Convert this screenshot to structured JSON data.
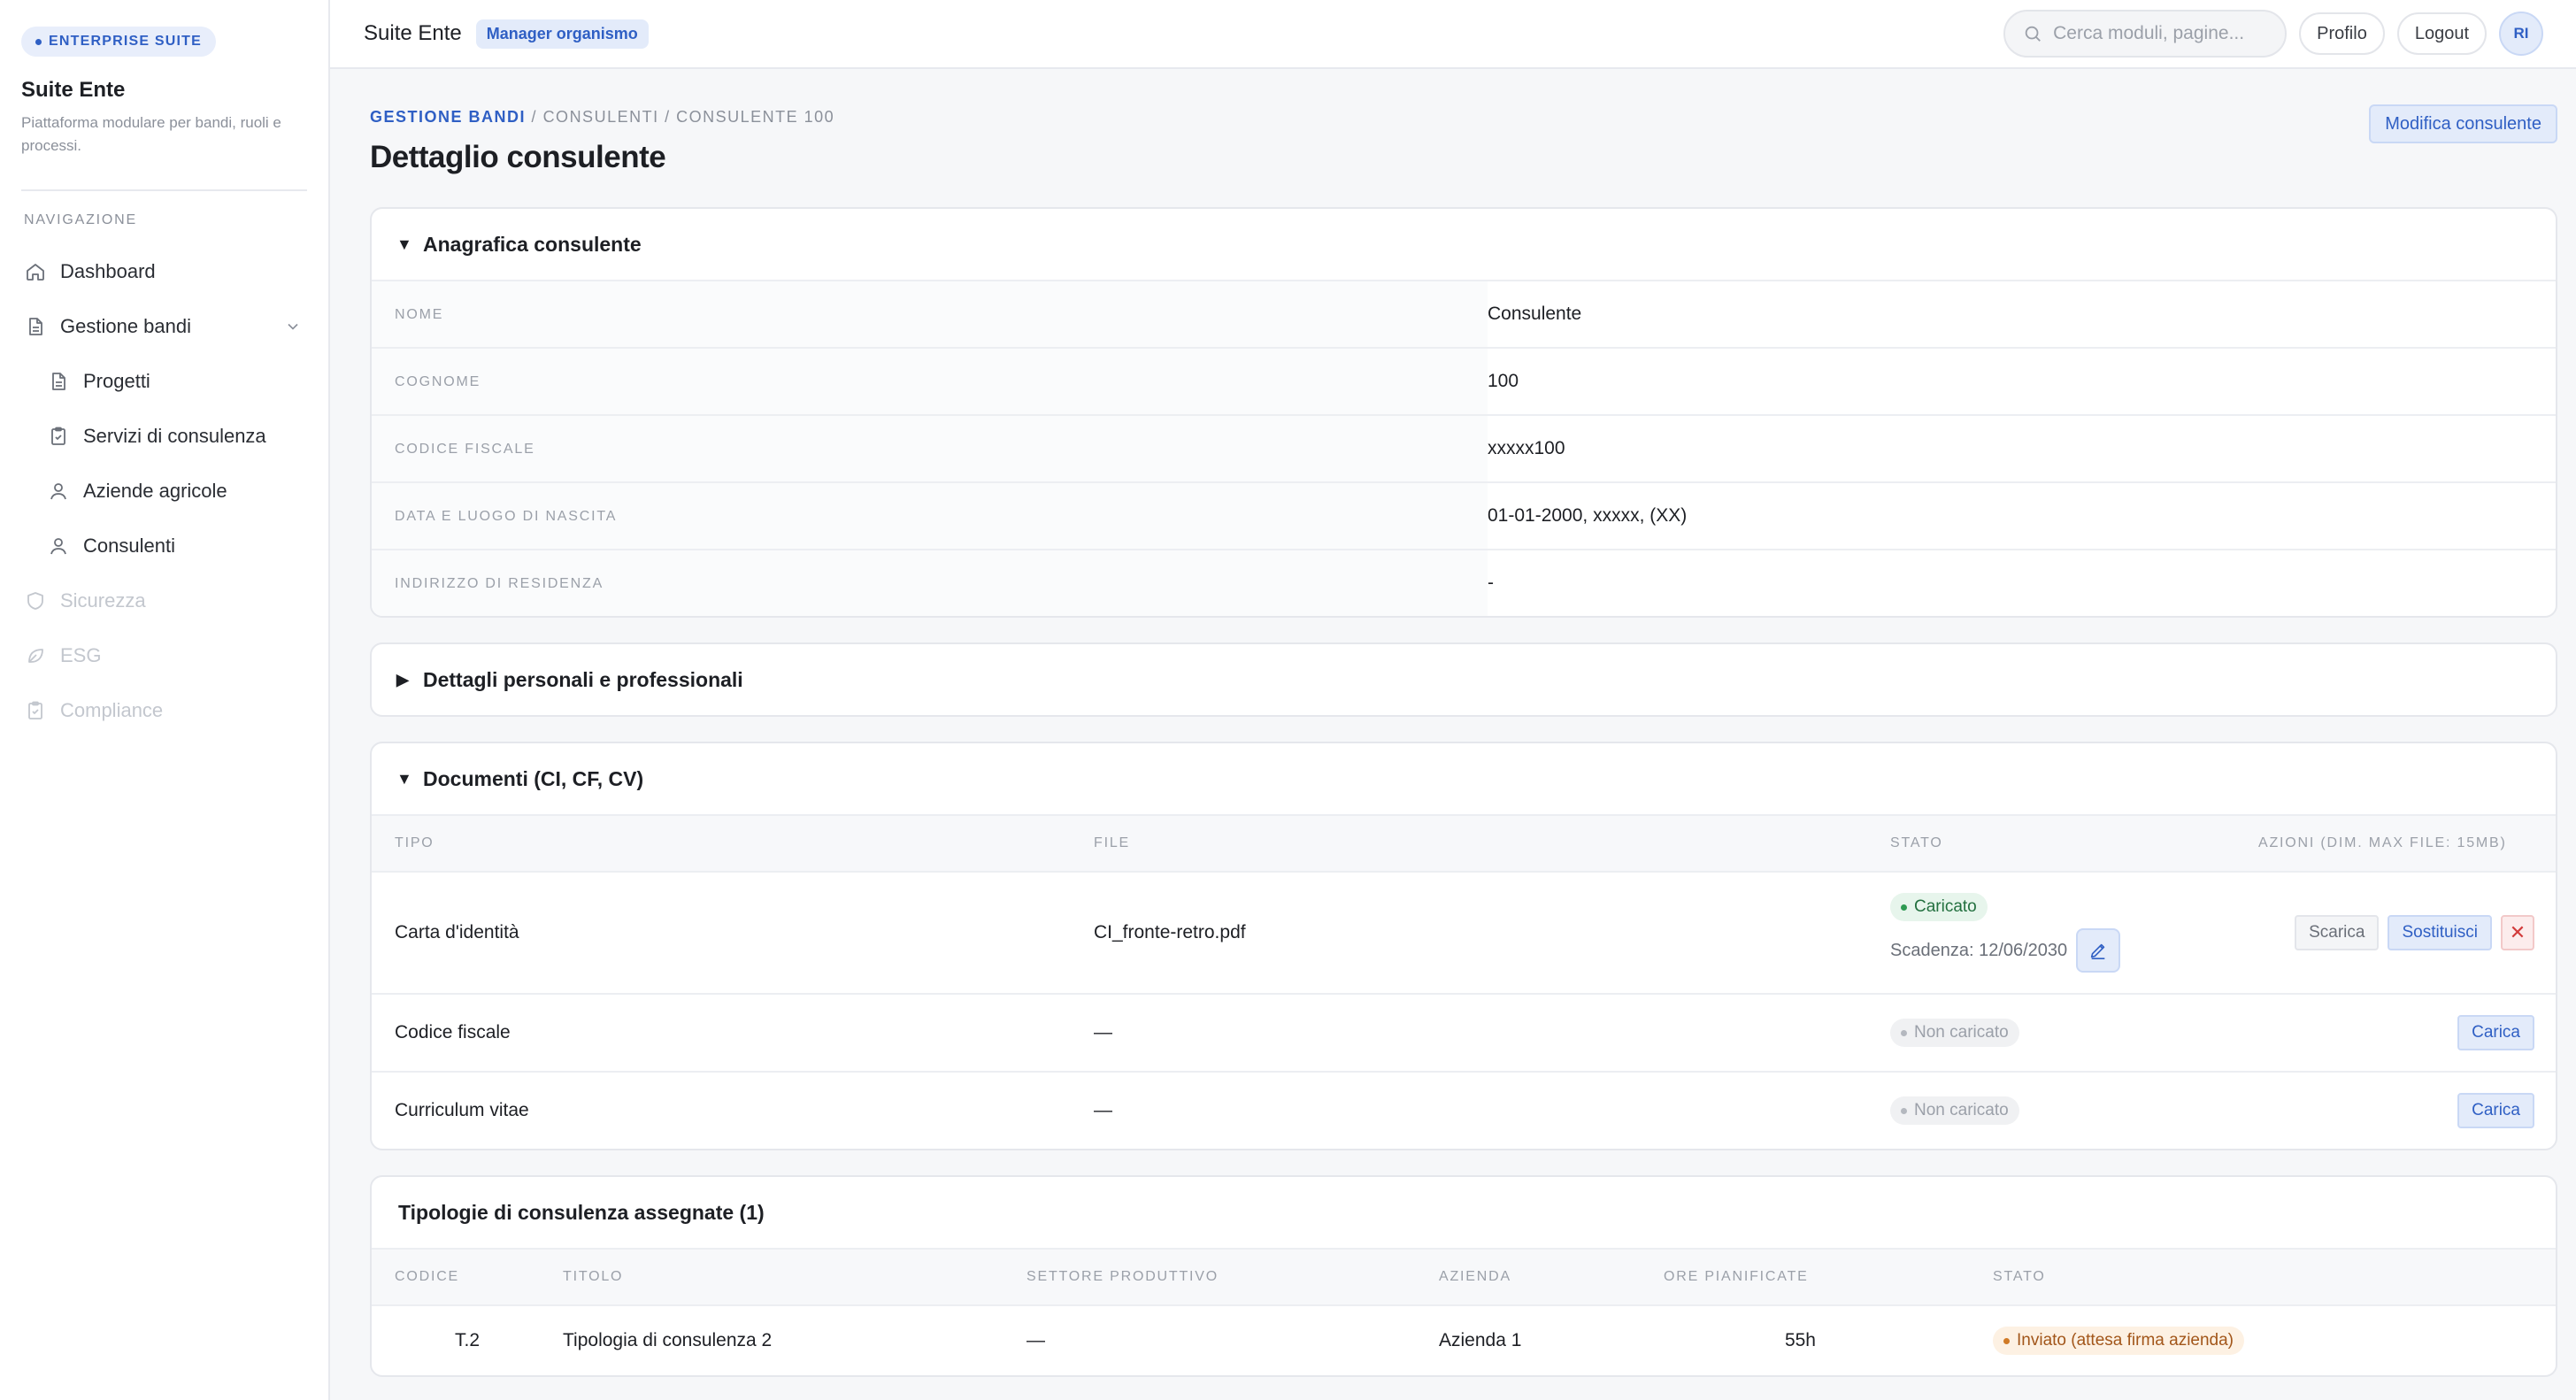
{
  "sidebar": {
    "suite_badge": "ENTERPRISE SUITE",
    "title": "Suite Ente",
    "subtitle": "Piattaforma modulare per bandi, ruoli e processi.",
    "nav_heading": "NAVIGAZIONE",
    "items": [
      {
        "label": "Dashboard",
        "icon": "home-icon",
        "state": "normal"
      },
      {
        "label": "Gestione bandi",
        "icon": "document-icon",
        "state": "expanded"
      },
      {
        "label": "Progetti",
        "icon": "document-icon",
        "state": "sub"
      },
      {
        "label": "Servizi di consulenza",
        "icon": "clipboard-check-icon",
        "state": "sub"
      },
      {
        "label": "Aziende agricole",
        "icon": "user-icon",
        "state": "sub"
      },
      {
        "label": "Consulenti",
        "icon": "user-icon",
        "state": "sub-active"
      },
      {
        "label": "Sicurezza",
        "icon": "shield-icon",
        "state": "disabled"
      },
      {
        "label": "ESG",
        "icon": "leaf-icon",
        "state": "disabled"
      },
      {
        "label": "Compliance",
        "icon": "clipboard-check-icon",
        "state": "disabled"
      }
    ]
  },
  "topbar": {
    "app_title": "Suite Ente",
    "role": "Manager organismo",
    "search_placeholder": "Cerca moduli, pagine...",
    "profile_label": "Profilo",
    "logout_label": "Logout",
    "avatar_initials": "RI"
  },
  "page": {
    "breadcrumb": {
      "link": "GESTIONE BANDI",
      "sep1": "/",
      "mid": "CONSULENTI",
      "sep2": "/",
      "current": "CONSULENTE 100"
    },
    "title": "Dettaglio consulente",
    "edit_button": "Modifica consulente"
  },
  "anagrafica": {
    "title": "Anagrafica consulente",
    "caret": "▼",
    "rows": [
      {
        "key": "NOME",
        "value": "Consulente"
      },
      {
        "key": "COGNOME",
        "value": "100"
      },
      {
        "key": "CODICE FISCALE",
        "value": "xxxxx100"
      },
      {
        "key": "DATA E LUOGO DI NASCITA",
        "value": "01-01-2000, xxxxx, (XX)"
      },
      {
        "key": "INDIRIZZO DI RESIDENZA",
        "value": "-"
      }
    ]
  },
  "dettagli": {
    "title": "Dettagli personali e professionali",
    "caret": "▶"
  },
  "documenti": {
    "title": "Documenti (CI, CF, CV)",
    "caret": "▼",
    "columns": [
      "TIPO",
      "FILE",
      "STATO",
      "AZIONI (DIM. MAX FILE: 15MB)"
    ],
    "rows": [
      {
        "tipo": "Carta d'identità",
        "file": "CI_fronte-retro.pdf",
        "stato": "Caricato",
        "scadenza": "Scadenza: 12/06/2030",
        "actions": {
          "download": "Scarica",
          "replace": "Sostituisci",
          "delete": "✕"
        }
      },
      {
        "tipo": "Codice fiscale",
        "file": "—",
        "stato": "Non caricato",
        "actions": {
          "upload": "Carica"
        }
      },
      {
        "tipo": "Curriculum vitae",
        "file": "—",
        "stato": "Non caricato",
        "actions": {
          "upload": "Carica"
        }
      }
    ]
  },
  "tipologie": {
    "title": "Tipologie di consulenza assegnate (1)",
    "columns": [
      "CODICE",
      "TITOLO",
      "SETTORE PRODUTTIVO",
      "AZIENDA",
      "ORE PIANIFICATE",
      "STATO"
    ],
    "rows": [
      {
        "codice": "T.2",
        "titolo": "Tipologia di consulenza 2",
        "settore": "—",
        "azienda": "Azienda 1",
        "ore": "55h",
        "stato": "Inviato (attesa firma azienda)"
      }
    ]
  },
  "colors": {
    "accent": "#2f5fc4",
    "success": "#2e9a52",
    "warning": "#d07a26",
    "danger": "#d23b3b"
  }
}
